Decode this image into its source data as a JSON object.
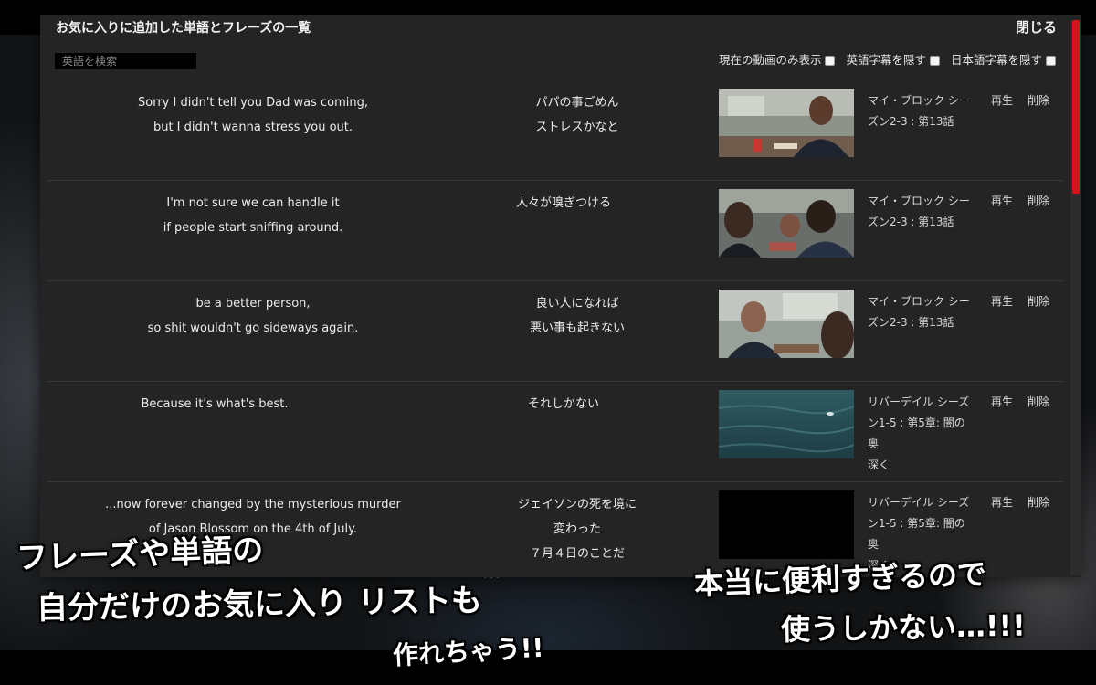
{
  "panel": {
    "title": "お気に入りに追加した単語とフレーズの一覧",
    "close_label": "閉じる"
  },
  "search": {
    "placeholder": "英語を検索",
    "value": ""
  },
  "filters": [
    {
      "label": "現在の動画のみ表示",
      "checked": false
    },
    {
      "label": "英語字幕を隠す",
      "checked": false
    },
    {
      "label": "日本語字幕を隠す",
      "checked": false
    }
  ],
  "rows": [
    {
      "en": [
        "Sorry I didn't tell you Dad was coming,",
        "but I didn't wanna stress you out."
      ],
      "ja": [
        "パパの事ごめん",
        "ストレスかなと"
      ],
      "show": [
        "マイ・ブロック シー",
        "ズン2-3 : 第13話"
      ],
      "play": "再生",
      "delete": "削除",
      "thumb": "cafeteria-scene-1"
    },
    {
      "en": [
        "I'm not sure we can handle it",
        "if people start sniffing around."
      ],
      "ja": [
        "人々が嗅ぎつける"
      ],
      "show": [
        "マイ・ブロック シー",
        "ズン2-3 : 第13話"
      ],
      "play": "再生",
      "delete": "削除",
      "thumb": "cafeteria-scene-2"
    },
    {
      "en": [
        "be a better person,",
        "so shit wouldn't go sideways again."
      ],
      "ja": [
        "良い人になれば",
        "悪い事も起きない"
      ],
      "show": [
        "マイ・ブロック シー",
        "ズン2-3 : 第13話"
      ],
      "play": "再生",
      "delete": "削除",
      "thumb": "cafeteria-scene-3"
    },
    {
      "en": [
        "Because it's what's best."
      ],
      "ja": [
        "それしかない"
      ],
      "show": [
        "リバーデイル シーズ",
        "ン1-5 : 第5章: 闇の奥",
        "深く"
      ],
      "play": "再生",
      "delete": "削除",
      "thumb": "water-scene"
    },
    {
      "en": [
        "...now forever changed by the mysterious murder",
        "of Jason Blossom on the 4th of July."
      ],
      "ja": [
        "ジェイソンの死を境に",
        "変わった",
        "７月４日のことだ"
      ],
      "show": [
        "リバーデイル シーズ",
        "ン1-5 : 第5章: 闇の奥",
        "深く"
      ],
      "play": "再生",
      "delete": "削除",
      "thumb": "black-frame"
    }
  ],
  "overlay_captions": {
    "left_1": "フレーズや単語の",
    "left_2": "自分だけのお気に入り リストも",
    "left_3": "作れちゃう!!",
    "right_1": "本当に便利すぎるので",
    "right_2": "使うしかない…!!!"
  },
  "colors": {
    "accent": "#d6121b",
    "panel": "#242424",
    "text": "#ececec"
  }
}
